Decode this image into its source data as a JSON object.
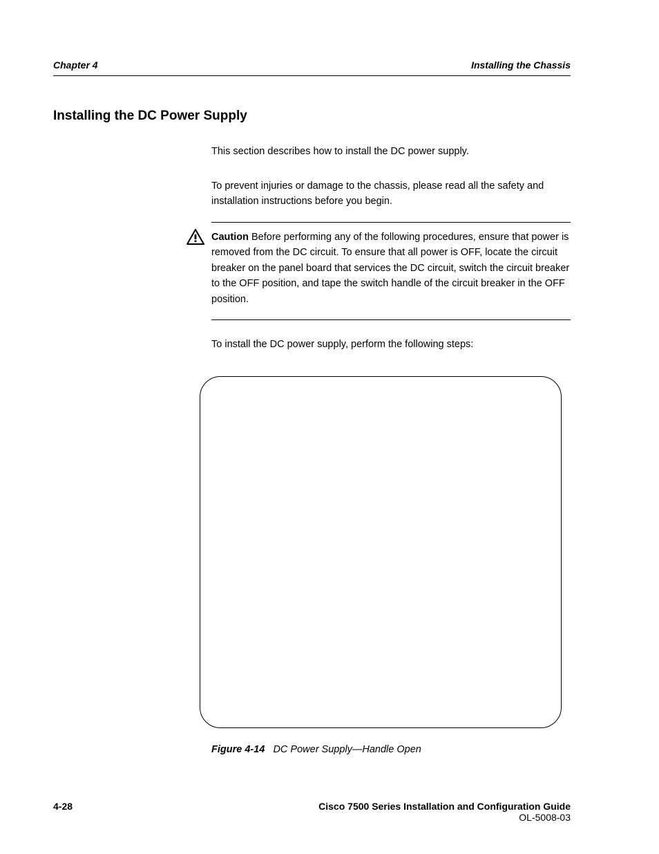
{
  "header": {
    "chapter": "Chapter 4",
    "title": "Installing the Chassis"
  },
  "section_heading": "Installing the DC Power Supply",
  "para1": "This section describes how to install the DC power supply.",
  "para2": "To prevent injuries or damage to the chassis, please read all the safety and installation instructions before you begin.",
  "caution": {
    "label": "Caution",
    "text": "Before performing any of the following procedures, ensure that power is removed from the DC circuit. To ensure that all power is OFF, locate the circuit breaker on the panel board that services the DC circuit, switch the circuit breaker to the OFF position, and tape the switch handle of the circuit breaker in the OFF position."
  },
  "para3": "To install the DC power supply, perform the following steps:",
  "figure": {
    "caption_prefix": "Figure 4-14",
    "caption_text": "DC Power Supply—Handle Open"
  },
  "footer": {
    "page_number": "4-28",
    "doc_title": "Cisco 7500 Series Installation and Configuration Guide",
    "doc_number": "OL-5008-03"
  }
}
